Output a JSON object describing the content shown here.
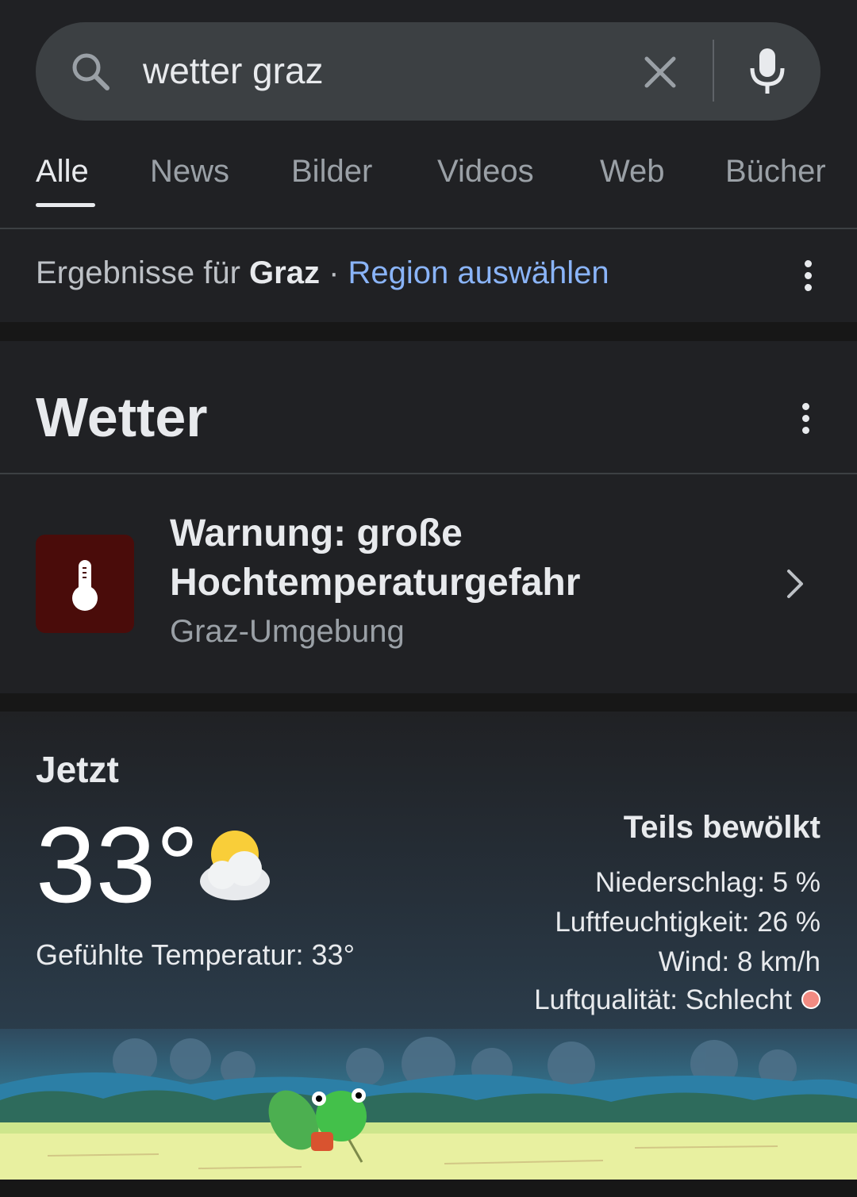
{
  "search": {
    "query": "wetter graz"
  },
  "tabs": [
    {
      "label": "Alle"
    },
    {
      "label": "News"
    },
    {
      "label": "Bilder"
    },
    {
      "label": "Videos"
    },
    {
      "label": "Web"
    },
    {
      "label": "Bücher"
    }
  ],
  "region": {
    "prefix": "Ergebnisse für",
    "location": "Graz",
    "separator": " · ",
    "link": "Region auswählen"
  },
  "weather_card": {
    "title": "Wetter",
    "warning": {
      "title": "Warnung: große Hochtemperaturgefahr",
      "area": "Graz-Umgebung",
      "icon": "thermometer-icon",
      "icon_bg": "#4a0c0a"
    },
    "now_label": "Jetzt",
    "temperature": "33°",
    "feels_like": "Gefühlte Temperatur: 33°",
    "condition": "Teils bewölkt",
    "condition_icon": "partly-cloudy-icon",
    "details": {
      "precipitation": "Niederschlag: 5 %",
      "humidity": "Luftfeuchtigkeit: 26 %",
      "wind": "Wind: 8 km/h",
      "air_quality": "Luftqualität: Schlecht",
      "air_quality_color": "#f28b82"
    }
  },
  "colors": {
    "background": "#202124",
    "link": "#8ab4f8",
    "search_bg": "#3c4043"
  }
}
